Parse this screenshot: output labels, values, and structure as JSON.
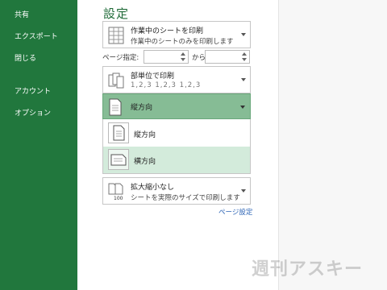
{
  "sidebar": {
    "items": [
      {
        "label": "共有"
      },
      {
        "label": "エクスポート"
      },
      {
        "label": "閉じる"
      },
      {
        "label": "アカウント"
      },
      {
        "label": "オプション"
      }
    ]
  },
  "print": {
    "title": "設定",
    "print_what": {
      "title": "作業中のシートを印刷",
      "subtitle": "作業中のシートのみを印刷します"
    },
    "pages": {
      "label": "ページ指定:",
      "from_value": "",
      "to_label": "から",
      "to_value": ""
    },
    "collate": {
      "title": "部単位で印刷",
      "subtitle": "1,2,3    1,2,3    1,2,3"
    },
    "orientation": {
      "selected_label": "縦方向",
      "options": [
        {
          "label": "縦方向"
        },
        {
          "label": "横方向"
        }
      ]
    },
    "scaling": {
      "title": "拡大縮小なし",
      "subtitle": "シートを実際のサイズで印刷します"
    },
    "page_setup_link": "ページ設定"
  },
  "colors": {
    "sidebar": "#21773d",
    "selected": "#86bc95",
    "hover": "#d3ebdb",
    "link": "#2b63b5"
  },
  "watermark": "週刊アスキー"
}
